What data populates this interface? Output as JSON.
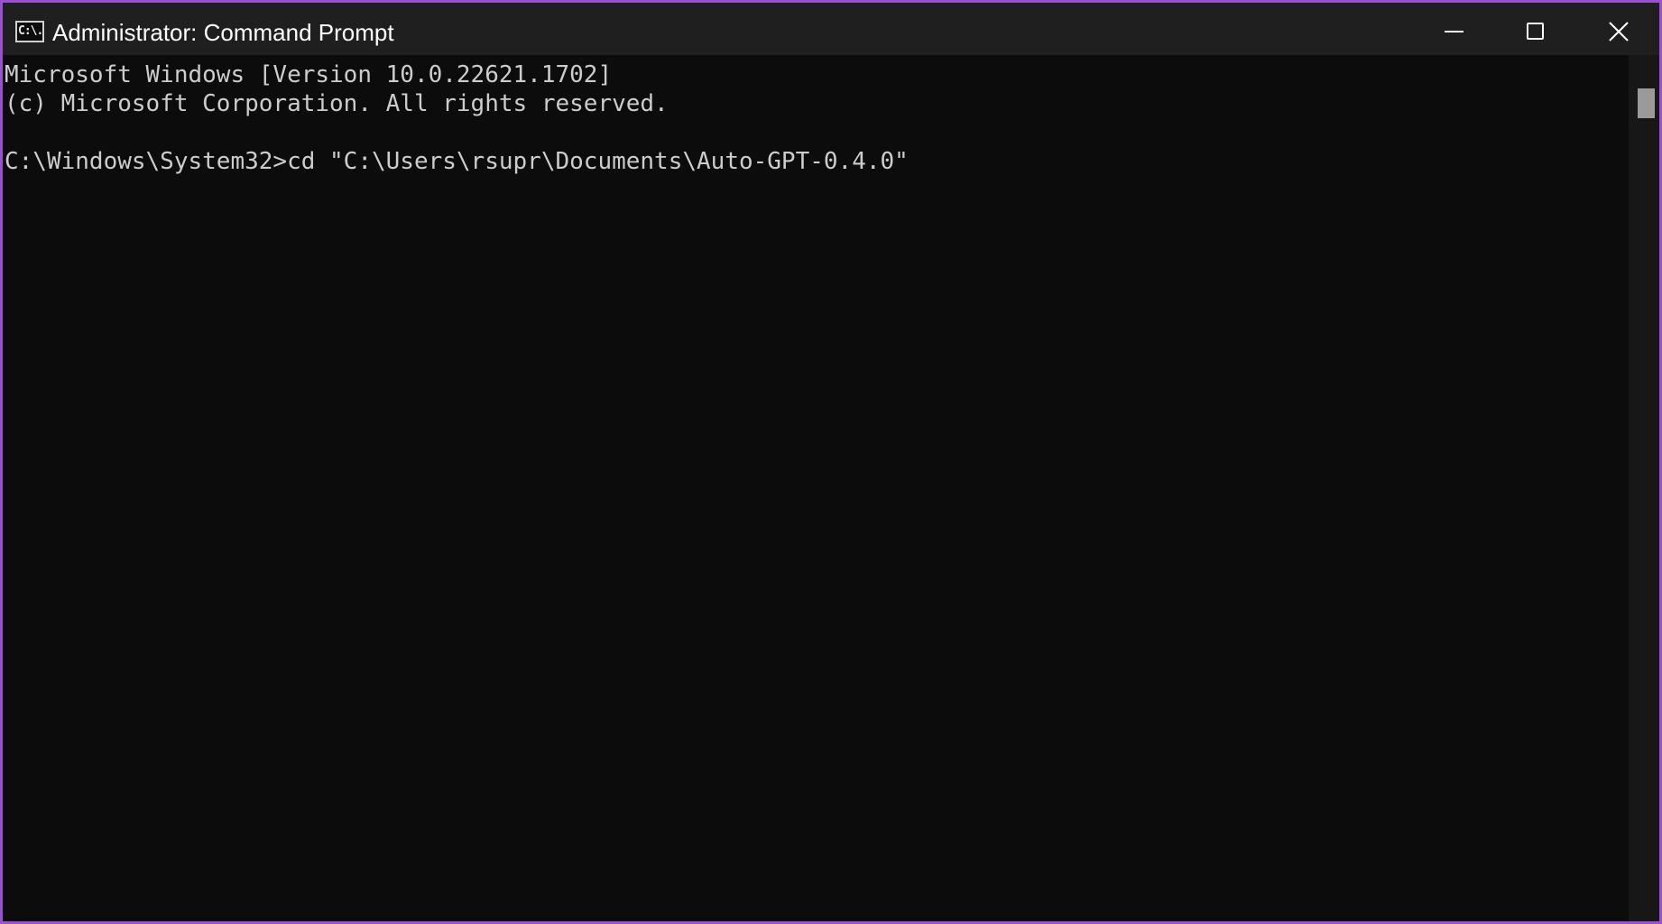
{
  "window": {
    "title": "Administrator: Command Prompt",
    "app_icon_glyph": "C:\\.",
    "accent_border_color": "#9b4fd1"
  },
  "console": {
    "lines": [
      "Microsoft Windows [Version 10.0.22621.1702]",
      "(c) Microsoft Corporation. All rights reserved.",
      "",
      "C:\\Windows\\System32>cd \"C:\\Users\\rsupr\\Documents\\Auto-GPT-0.4.0\""
    ],
    "text_color": "#cccccc",
    "background_color": "#0c0c0c"
  },
  "icons": {
    "minimize": "minimize-icon",
    "maximize": "maximize-icon",
    "close": "close-icon"
  }
}
